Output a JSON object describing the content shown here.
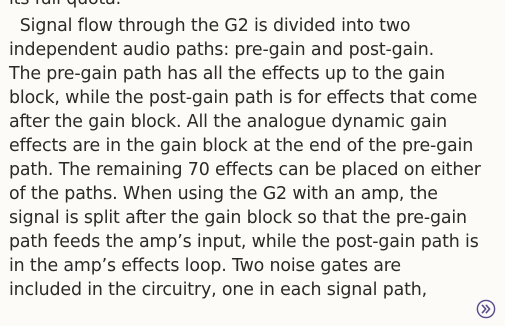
{
  "article": {
    "clipped_top_line": "its full quota.",
    "lines": [
      "  Signal flow through the G2 is divided into two",
      "independent audio paths: pre-gain and post-gain.",
      "The pre-gain path has all the effects up to the gain",
      "block, while the post-gain path is for effects that come",
      "after the gain block. All the analogue dynamic gain",
      "effects are in the gain block at the end of the pre-gain",
      "path. The remaining 70 effects can be placed on either",
      "of the paths. When using the G2 with an amp, the",
      "signal is split after the gain block so that the pre-gain",
      "path feeds the amp’s input, while the post-gain path is",
      "in the amp’s effects loop. Two noise gates are",
      "included in the circuitry, one in each signal path,"
    ],
    "continue_icon": "double-chevron-right-icon",
    "accent_color": "#5a4a8c"
  }
}
